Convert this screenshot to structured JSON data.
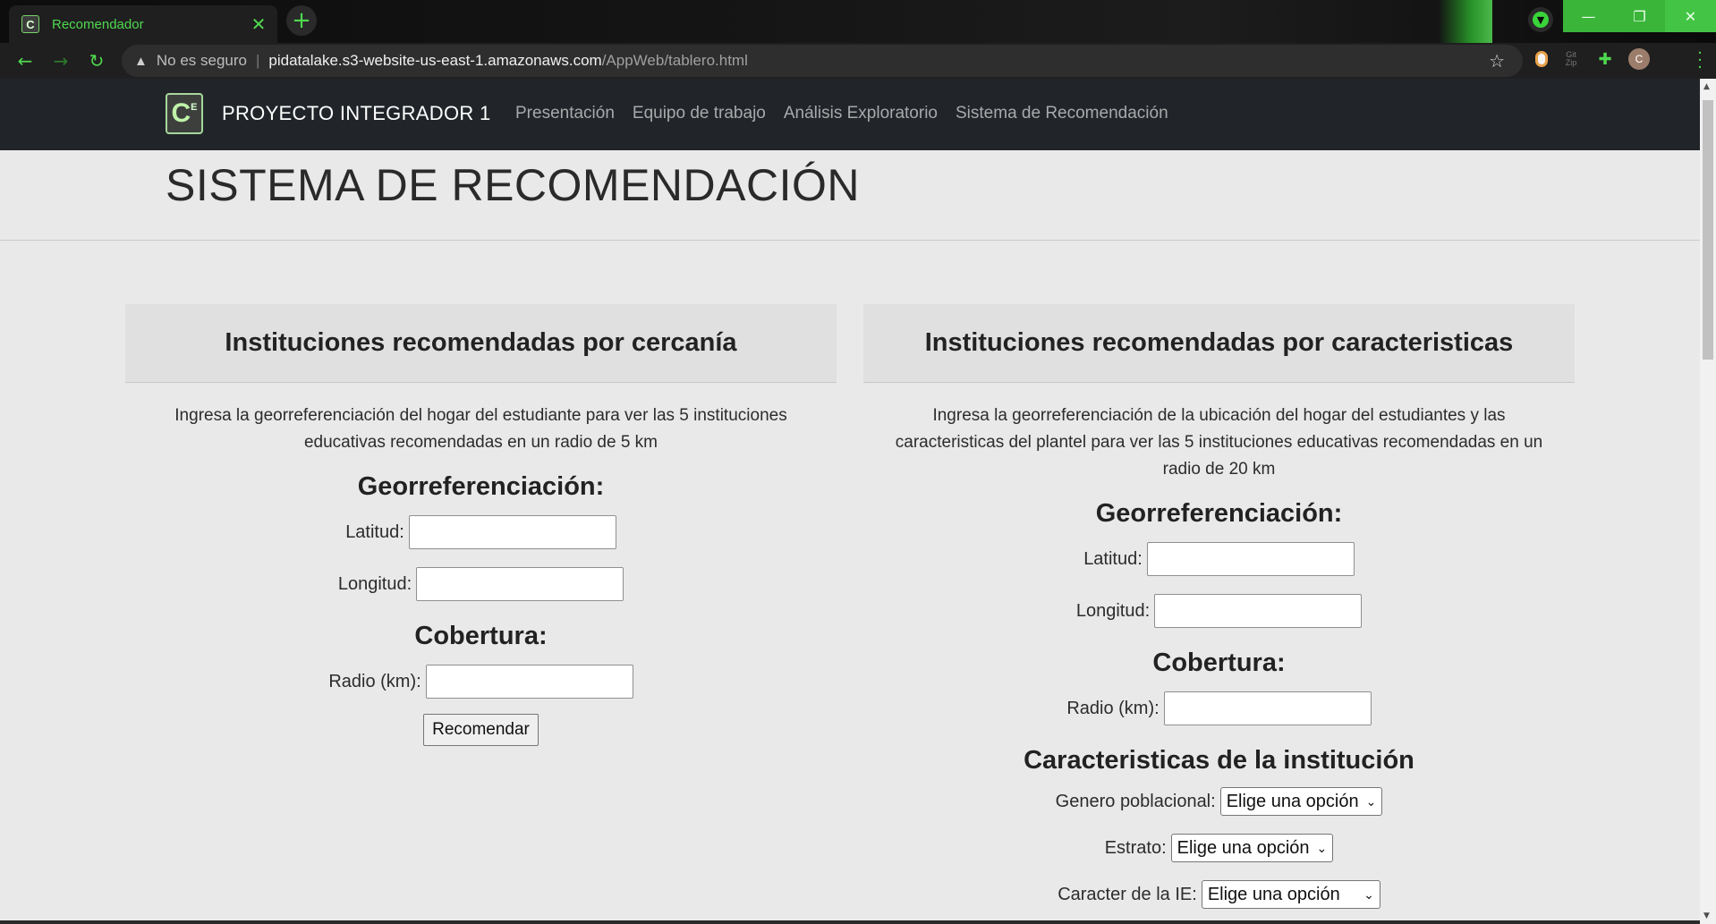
{
  "browser": {
    "tab_title": "Recomendador",
    "favicon_text": "C",
    "tab_close": "✕",
    "new_tab": "+",
    "security_label": "No es seguro",
    "url_host": "pidatalake.s3-website-us-east-1.amazonaws.com",
    "url_path": "/AppWeb/tablero.html",
    "avatar_letter": "C",
    "accent_color": "#4fd84f"
  },
  "site": {
    "logo_text": "C",
    "logo_sup": "E",
    "brand": "PROYECTO INTEGRADOR 1",
    "nav": [
      "Presentación",
      "Equipo de trabajo",
      "Análisis Exploratorio",
      "Sistema de Recomendación"
    ]
  },
  "page": {
    "title": "SISTEMA DE RECOMENDACIÓN"
  },
  "left_card": {
    "header": "Instituciones recomendadas por cercanía",
    "description": "Ingresa la georreferenciación del hogar del estudiante para ver las 5 instituciones educativas recomendadas en un radio de 5 km",
    "geo_heading": "Georreferenciación:",
    "lat_label": "Latitud:",
    "lon_label": "Longitud:",
    "coverage_heading": "Cobertura:",
    "radius_label": "Radio (km):",
    "button": "Recomendar"
  },
  "right_card": {
    "header": "Instituciones recomendadas por caracteristicas",
    "description": "Ingresa la georreferenciación de la ubicación del hogar del estudiantes y las caracteristicas del plantel para ver las 5 instituciones educativas recomendadas en un radio de 20 km",
    "geo_heading": "Georreferenciación:",
    "lat_label": "Latitud:",
    "lon_label": "Longitud:",
    "coverage_heading": "Cobertura:",
    "radius_label": "Radio (km):",
    "features_heading": "Caracteristicas de la institución",
    "gender_label": "Genero poblacional:",
    "stratum_label": "Estrato:",
    "character_label": "Caracter de la IE:",
    "select_placeholder": "Elige una opción"
  }
}
